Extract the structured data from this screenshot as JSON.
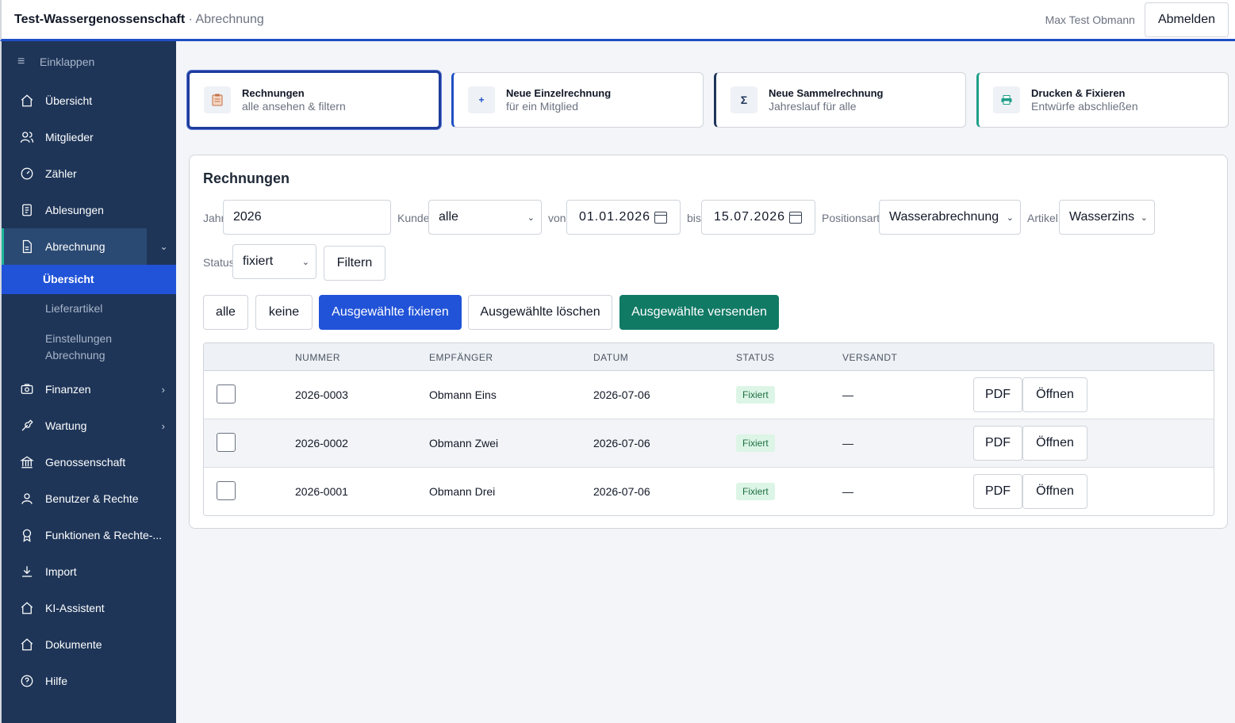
{
  "header": {
    "app_name": "Test-Wassergenossenschaft",
    "separator": " · ",
    "section": "Abrechnung",
    "user_name": "Max Test Obmann",
    "logout_label": "Abmelden"
  },
  "sidebar": {
    "collapse_label": "Einklappen",
    "items": [
      {
        "label": "Übersicht",
        "icon": "home-icon"
      },
      {
        "label": "Mitglieder",
        "icon": "users-icon"
      },
      {
        "label": "Zähler",
        "icon": "gauge-icon"
      },
      {
        "label": "Ablesungen",
        "icon": "clipboard-icon"
      },
      {
        "label": "Abrechnung",
        "icon": "document-icon"
      },
      {
        "label": "Finanzen",
        "icon": "camera-icon"
      },
      {
        "label": "Wartung",
        "icon": "wrench-icon"
      },
      {
        "label": "Genossenschaft",
        "icon": "bank-icon"
      },
      {
        "label": "Benutzer & Rechte",
        "icon": "user-icon"
      },
      {
        "label": "Funktionen & Rechte-...",
        "icon": "award-icon"
      },
      {
        "label": "Import",
        "icon": "download-icon"
      },
      {
        "label": "KI-Assistent",
        "icon": "home-icon"
      },
      {
        "label": "Dokumente",
        "icon": "home-icon"
      },
      {
        "label": "Hilfe",
        "icon": "help-icon"
      }
    ],
    "sub_items": {
      "overview": "Übersicht",
      "delivery": "Lieferartikel",
      "settings_line1": "Einstellungen",
      "settings_line2": "Abrechnung"
    }
  },
  "cards": [
    {
      "title": "Rechnungen",
      "subtitle": "alle ansehen & filtern",
      "icon": "clipboard-icon"
    },
    {
      "title": "Neue Einzelrechnung",
      "subtitle": "für ein Mitglied",
      "icon": "plus-icon",
      "glyph": "+"
    },
    {
      "title": "Neue Sammelrechnung",
      "subtitle": "Jahreslauf für alle",
      "icon": "sigma-icon",
      "glyph": "Σ"
    },
    {
      "title": "Drucken & Fixieren",
      "subtitle": "Entwürfe abschließen",
      "icon": "printer-icon"
    }
  ],
  "panel": {
    "title": "Rechnungen",
    "filters": {
      "year_label": "Jahr",
      "year_value": "2026",
      "customer_label": "Kunde",
      "customer_value": "alle",
      "from_label": "von",
      "from_value": "01.01.2026",
      "to_label": "bis",
      "to_value": "15.07.2026",
      "position_label": "Positionsart",
      "position_value": "Wasserabrechnung",
      "article_label": "Artikel",
      "article_value": "Wasserzins",
      "status_label": "Status",
      "status_value": "fixiert",
      "filter_button": "Filtern"
    },
    "actions": {
      "all": "alle",
      "none": "keine",
      "fix_selected": "Ausgewählte fixieren",
      "delete_selected": "Ausgewählte löschen",
      "send_selected": "Ausgewählte versenden"
    },
    "table": {
      "columns": [
        "NUMMER",
        "EMPFÄNGER",
        "DATUM",
        "STATUS",
        "VERSANDT"
      ],
      "pdf_label": "PDF",
      "open_label": "Öffnen",
      "rows": [
        {
          "number": "2026-0003",
          "recipient": "Obmann Eins",
          "date": "2026-07-06",
          "status": "Fixiert",
          "sent": "—"
        },
        {
          "number": "2026-0002",
          "recipient": "Obmann Zwei",
          "date": "2026-07-06",
          "status": "Fixiert",
          "sent": "—"
        },
        {
          "number": "2026-0001",
          "recipient": "Obmann Drei",
          "date": "2026-07-06",
          "status": "Fixiert",
          "sent": "—"
        }
      ]
    }
  }
}
